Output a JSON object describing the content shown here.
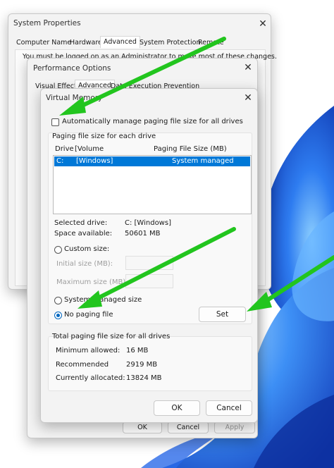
{
  "system_properties": {
    "title": "System Properties",
    "tabs": [
      "Computer Name",
      "Hardware",
      "Advanced",
      "System Protection",
      "Remote"
    ],
    "active_tab": "Advanced",
    "notice": "You must be logged on as an Administrator to make most of these changes.",
    "buttons": {
      "ok": "OK",
      "cancel": "Cancel",
      "apply": "Apply"
    }
  },
  "performance_options": {
    "title": "Performance Options",
    "tabs": [
      "Visual Effects",
      "Advanced",
      "Data Execution Prevention"
    ]
  },
  "virtual_memory": {
    "title": "Virtual Memory",
    "auto_manage_label": "Automatically manage paging file size for all drives",
    "auto_manage_checked": false,
    "group_title": "Paging file size for each drive",
    "list_headers": {
      "drive": "Drive",
      "volume": "[Volume",
      "size": "Paging File Size (MB)"
    },
    "list_rows": [
      {
        "drive": "C:",
        "volume": "[Windows]",
        "size": "System managed"
      }
    ],
    "selected_drive_label": "Selected drive:",
    "selected_drive_value": "C:  [Windows]",
    "space_available_label": "Space available:",
    "space_available_value": "50601 MB",
    "custom_size_label": "Custom size:",
    "initial_size_label": "Initial size (MB):",
    "maximum_size_label": "Maximum size (MB):",
    "system_managed_label": "System managed size",
    "no_paging_label": "No paging file",
    "selected_option": "no_paging",
    "set_button": "Set",
    "totals_title": "Total paging file size for all drives",
    "minimum_allowed_label": "Minimum allowed:",
    "minimum_allowed_value": "16 MB",
    "recommended_label": "Recommended",
    "recommended_value": "2919 MB",
    "currently_allocated_label": "Currently allocated:",
    "currently_allocated_value": "13824 MB",
    "ok_button": "OK",
    "cancel_button": "Cancel"
  },
  "colors": {
    "arrow": "#22c51e",
    "selection": "#0078d7",
    "wallpaper_blue": "#1a56d6"
  }
}
